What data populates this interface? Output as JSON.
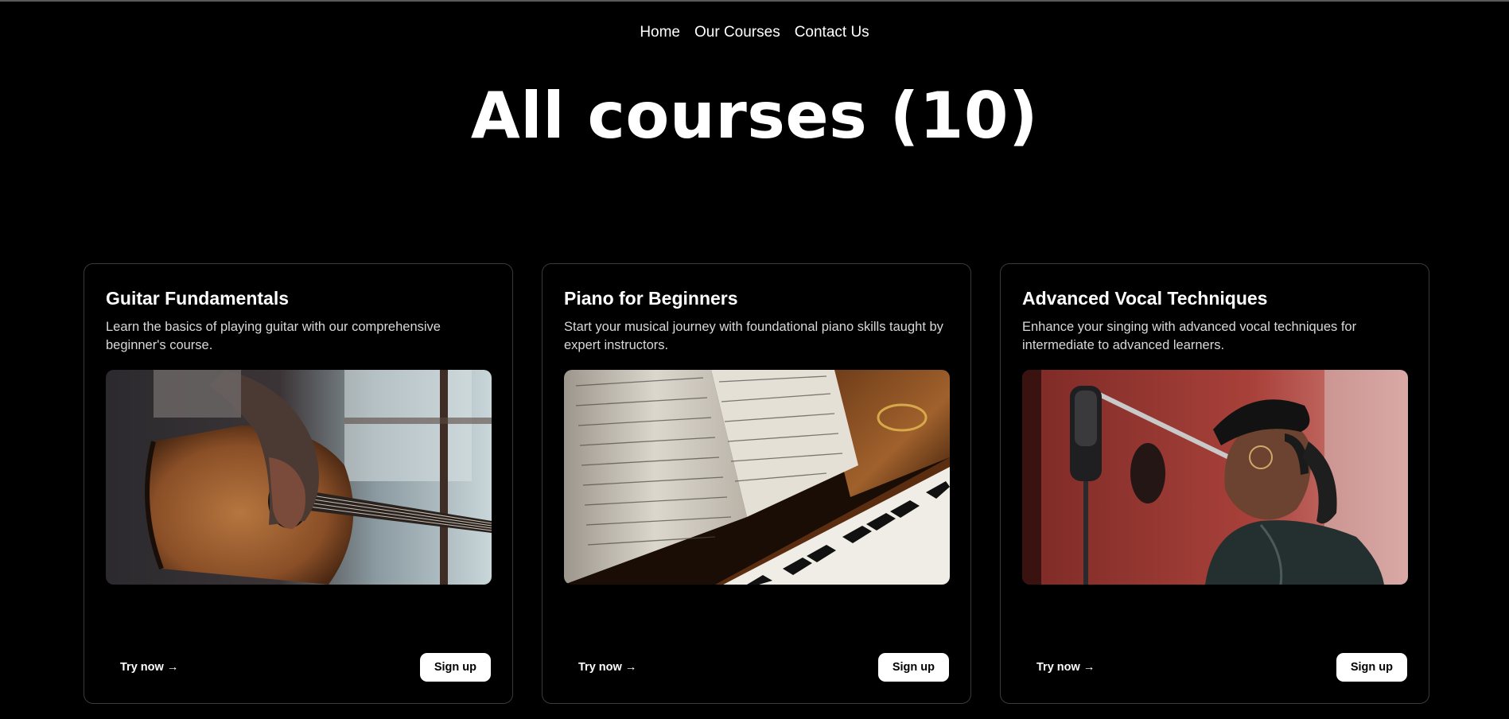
{
  "nav": {
    "items": [
      {
        "label": "Home"
      },
      {
        "label": "Our Courses"
      },
      {
        "label": "Contact Us"
      }
    ]
  },
  "page": {
    "title": "All courses (10)"
  },
  "courses": [
    {
      "title": "Guitar Fundamentals",
      "description": "Learn the basics of playing guitar with our comprehensive beginner's course.",
      "image": "guitar-photo",
      "try_label": "Try now →",
      "signup_label": "Sign up"
    },
    {
      "title": "Piano for Beginners",
      "description": "Start your musical journey with foundational piano skills taught by expert instructors.",
      "image": "piano-photo",
      "try_label": "Try now →",
      "signup_label": "Sign up"
    },
    {
      "title": "Advanced Vocal Techniques",
      "description": "Enhance your singing with advanced vocal techniques for intermediate to advanced learners.",
      "image": "vocal-photo",
      "try_label": "Try now →",
      "signup_label": "Sign up"
    }
  ],
  "colors": {
    "background": "#000000",
    "text": "#ffffff",
    "card_border": "#3a3a3a",
    "button_bg": "#ffffff"
  }
}
